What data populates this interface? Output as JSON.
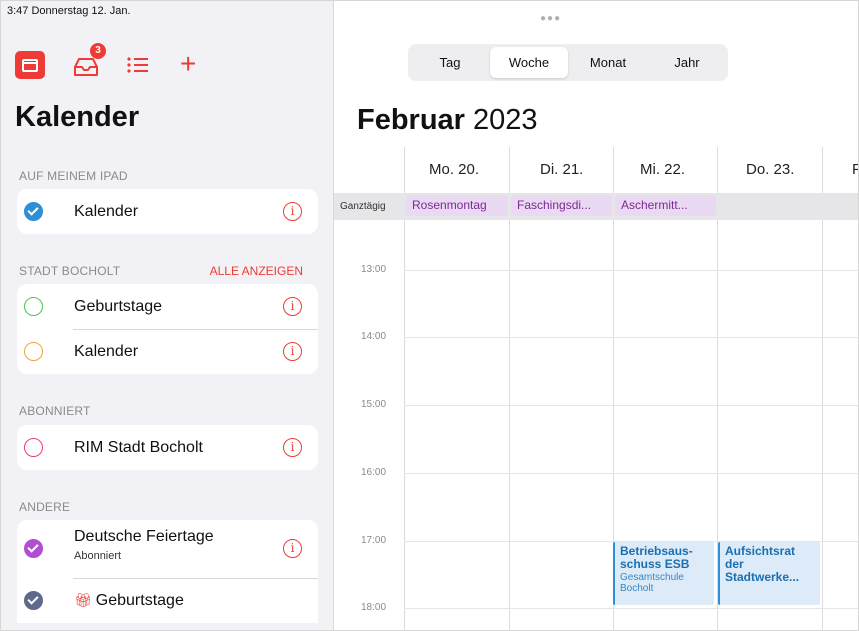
{
  "status_bar": {
    "time_date": "3:47  Donnerstag 12. Jan."
  },
  "toolbar": {
    "inbox_badge": "3",
    "plus_label": "+",
    "accent_color": "#ee3b35"
  },
  "sidebar": {
    "title": "Kalender",
    "sections": [
      {
        "header": "AUF MEINEM IPAD",
        "items": [
          {
            "label": "Kalender",
            "color": "#2e8fd8",
            "checked": true
          }
        ]
      },
      {
        "header": "STADT BOCHOLT",
        "action": "ALLE ANZEIGEN",
        "items": [
          {
            "label": "Geburtstage",
            "color": "#4cc35a",
            "checked": false
          },
          {
            "label": "Kalender",
            "color": "#f0a33a",
            "checked": false
          }
        ]
      },
      {
        "header": "ABONNIERT",
        "items": [
          {
            "label": "RIM Stadt Bocholt",
            "color": "#e5426e",
            "checked": false
          }
        ]
      },
      {
        "header": "ANDERE",
        "items": [
          {
            "label": "Deutsche Feiertage",
            "sublabel": "Abonniert",
            "color": "#b04fcf",
            "checked": true
          },
          {
            "label": "Geburtstage",
            "color": "#5f6a8a",
            "checked": true,
            "icon": "gift-icon"
          }
        ]
      }
    ]
  },
  "main": {
    "view_options": [
      "Tag",
      "Woche",
      "Monat",
      "Jahr"
    ],
    "active_view": "Woche",
    "month": "Februar",
    "year": "2023",
    "days": [
      "Mo. 20.",
      "Di. 21.",
      "Mi. 22.",
      "Do. 23.",
      "F"
    ],
    "allday_label": "Ganztägig",
    "allday_events": [
      "Rosenmontag",
      "Faschingsdi...",
      "Aschermitt..."
    ],
    "hours": [
      "13:00",
      "14:00",
      "15:00",
      "16:00",
      "17:00",
      "18:00"
    ],
    "events": [
      {
        "title": "Betriebsaus-\nschuss ESB",
        "location": "Gesamtschule\nBocholt"
      },
      {
        "title": "Aufsichtsrat\nder\nStadtwerke..."
      }
    ],
    "event_color": "#2e8fd8"
  }
}
